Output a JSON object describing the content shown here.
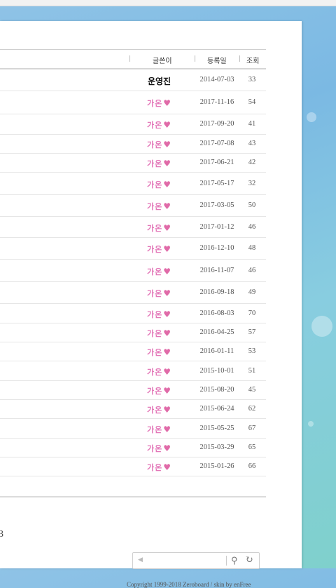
{
  "header": {
    "writer_label": "글쓴이",
    "date_label": "등록일",
    "hits_label": "조회"
  },
  "rows": [
    {
      "writer": "운영진",
      "date": "2014-07-03",
      "hits": "33",
      "admin": true
    },
    {
      "writer": "가온",
      "date": "2017-11-16",
      "hits": "54"
    },
    {
      "writer": "가온",
      "date": "2017-09-20",
      "hits": "41"
    },
    {
      "writer": "가온",
      "date": "2017-07-08",
      "hits": "43"
    },
    {
      "writer": "가온",
      "date": "2017-06-21",
      "hits": "42"
    },
    {
      "writer": "가온",
      "date": "2017-05-17",
      "hits": "32"
    },
    {
      "writer": "가온",
      "date": "2017-03-05",
      "hits": "50"
    },
    {
      "writer": "가온",
      "date": "2017-01-12",
      "hits": "46"
    },
    {
      "writer": "가온",
      "date": "2016-12-10",
      "hits": "48"
    },
    {
      "writer": "가온",
      "date": "2016-11-07",
      "hits": "46"
    },
    {
      "writer": "가온",
      "date": "2016-09-18",
      "hits": "49"
    },
    {
      "writer": "가온",
      "date": "2016-08-03",
      "hits": "70"
    },
    {
      "writer": "가온",
      "date": "2016-04-25",
      "hits": "57"
    },
    {
      "writer": "가온",
      "date": "2016-01-11",
      "hits": "53"
    },
    {
      "writer": "가온",
      "date": "2015-10-01",
      "hits": "51"
    },
    {
      "writer": "가온",
      "date": "2015-08-20",
      "hits": "45"
    },
    {
      "writer": "가온",
      "date": "2015-06-24",
      "hits": "62"
    },
    {
      "writer": "가온",
      "date": "2015-05-25",
      "hits": "67"
    },
    {
      "writer": "가온",
      "date": "2015-03-29",
      "hits": "65"
    },
    {
      "writer": "가온",
      "date": "2015-01-26",
      "hits": "66"
    }
  ],
  "pagination": {
    "current_page": "3"
  },
  "search": {
    "arrow_icon": "caret-left-icon",
    "search_icon": "search-icon",
    "refresh_icon": "refresh-icon"
  },
  "footer": {
    "copyright": "Copyright 1999-2018 Zeroboard / skin by enFree"
  },
  "colors": {
    "writer_nick": "#e377b8",
    "heart": "#e06aa8",
    "background": "#7fc0e0"
  }
}
